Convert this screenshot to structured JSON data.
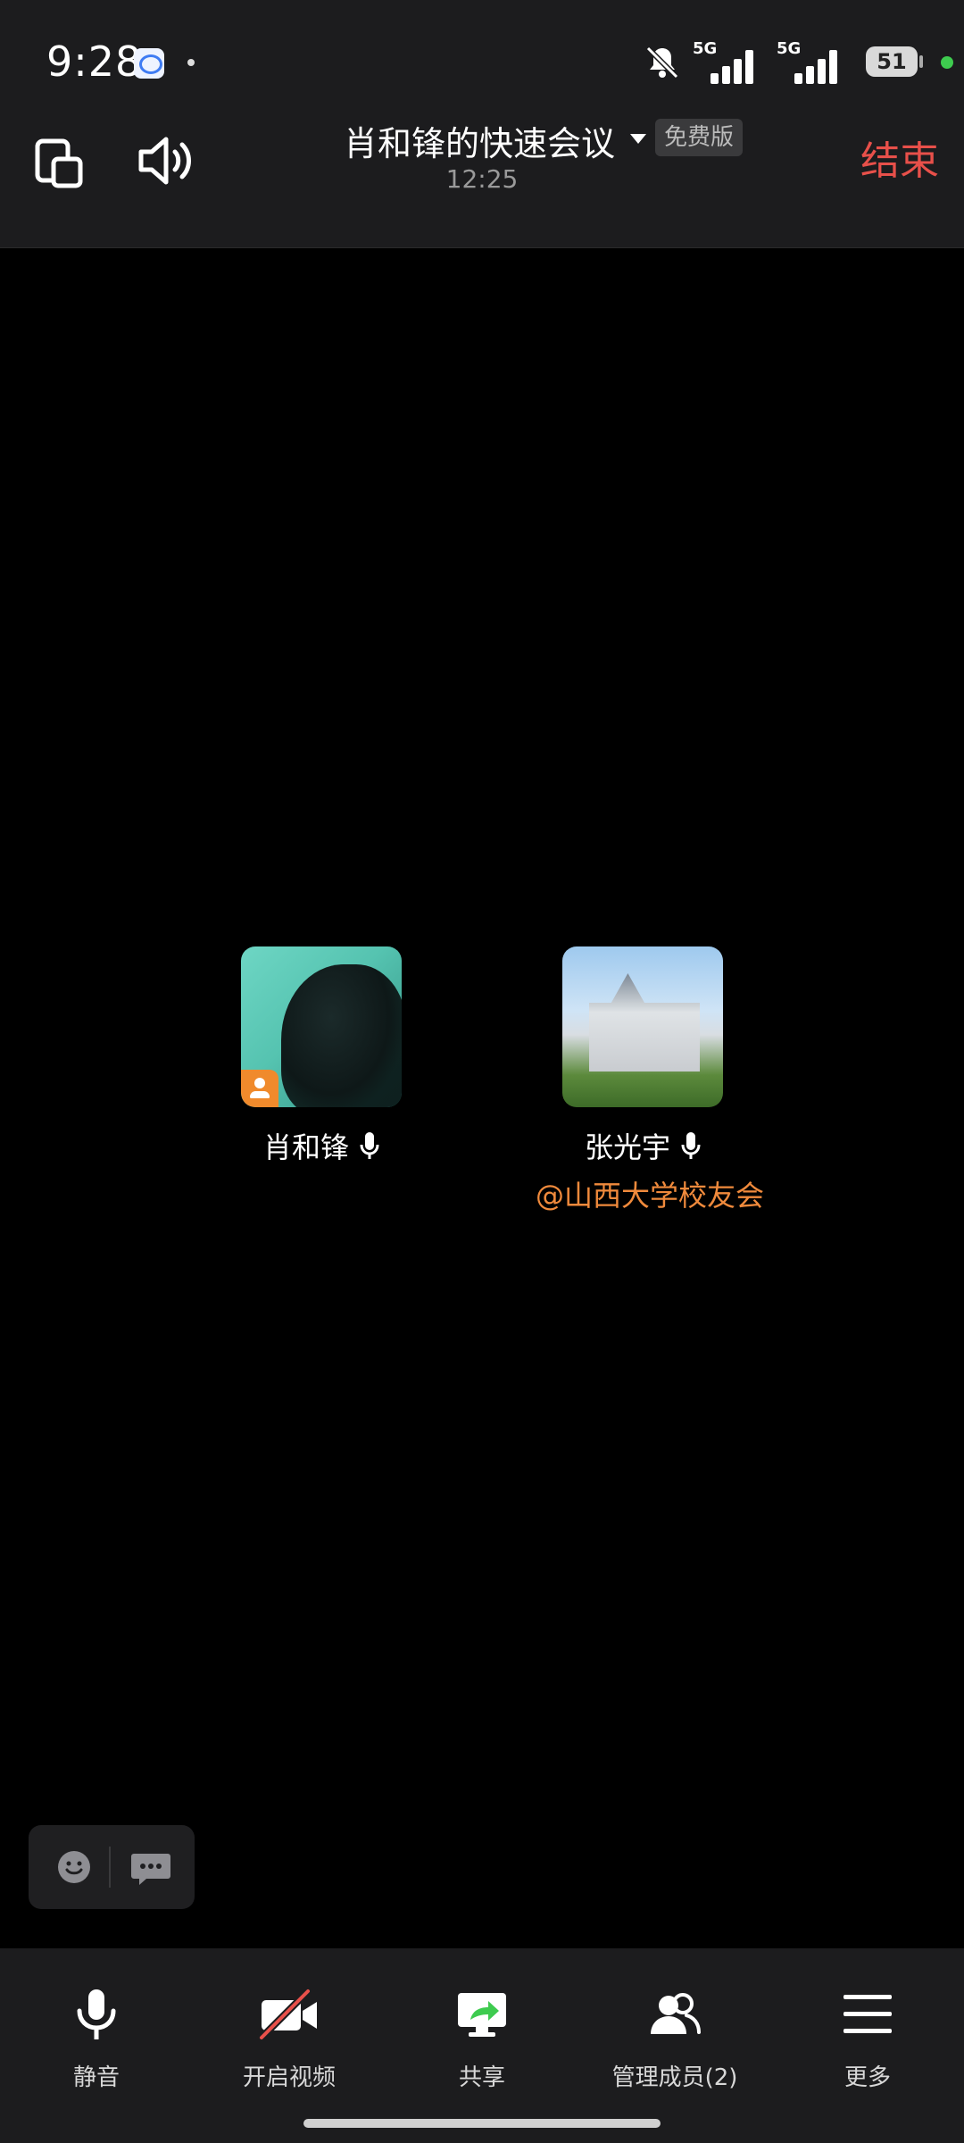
{
  "status_bar": {
    "time": "9:28",
    "network_1": "5G",
    "network_2": "5G",
    "battery": "51"
  },
  "header": {
    "meeting_title": "肖和锋的快速会议",
    "plan_badge": "免费版",
    "duration": "12:25",
    "end_label": "结束"
  },
  "participants": [
    {
      "name": "肖和锋",
      "org": "",
      "role": "host"
    },
    {
      "name": "张光宇",
      "org": "@山西大学校友会",
      "role": "member"
    }
  ],
  "toolbar": {
    "mute_label": "静音",
    "video_label": "开启视频",
    "share_label": "共享",
    "members_label": "管理成员(2)",
    "more_label": "更多"
  },
  "colors": {
    "end_red": "#e8504a",
    "org_orange": "#f08a3c",
    "host_badge": "#f08a2c",
    "share_green": "#3ecb4f"
  },
  "icons": [
    "switch-layout-icon",
    "speaker-icon",
    "mic-icon",
    "video-off-icon",
    "share-screen-icon",
    "members-icon",
    "menu-icon",
    "emoji-icon",
    "chat-icon"
  ]
}
